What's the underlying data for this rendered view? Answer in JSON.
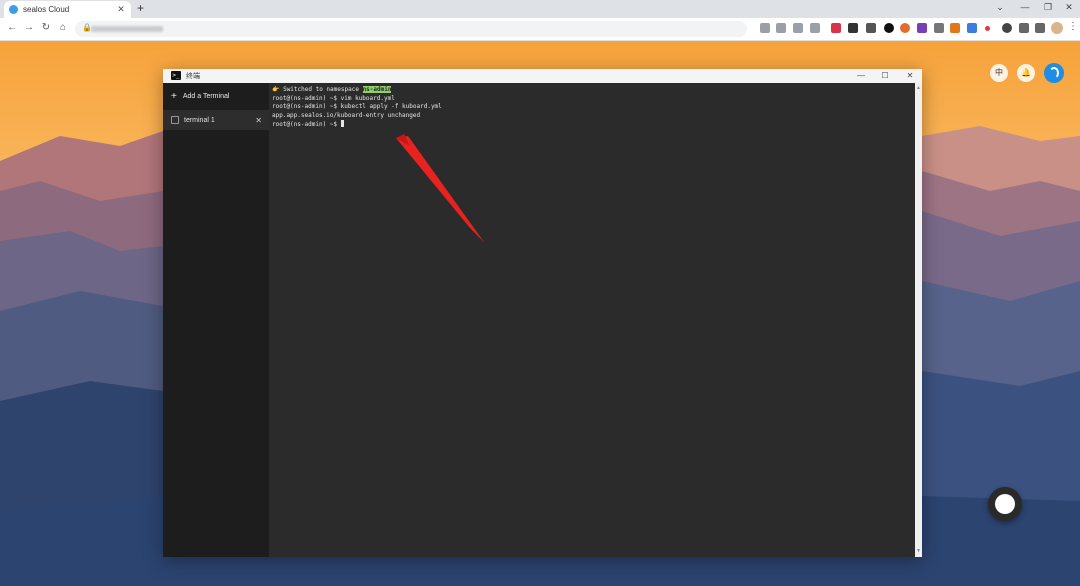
{
  "browser": {
    "tab_title": "sealos Cloud",
    "tab_close": "✕",
    "new_tab": "+",
    "window_controls": {
      "collapse": "⌄",
      "minimize": "—",
      "restore": "❐",
      "close": "✕"
    },
    "nav": {
      "back": "←",
      "forward": "→",
      "reload": "↻",
      "home": "⌂"
    },
    "lock": "🔒",
    "menu": "⋮"
  },
  "desktop": {
    "language_button": "中",
    "bell": "🔔"
  },
  "terminal_window": {
    "title": "终端",
    "icon_glyph": ">_",
    "controls": {
      "minimize": "—",
      "maximize": "☐",
      "close": "✕"
    },
    "sidebar": {
      "add_label": "Add a Terminal",
      "add_plus": "+",
      "items": [
        {
          "label": "terminal 1",
          "close": "✕"
        }
      ]
    },
    "console": {
      "line1_prefix": "👉 Switched to namespace ",
      "line1_ns": "ns-admin",
      "line2": "root@(ns-admin) ~$ vim kuboard.yml",
      "line3": "root@(ns-admin) ~$ kubectl apply -f kuboard.yml",
      "line4": "app.app.sealos.io/kuboard-entry unchanged",
      "line5": "root@(ns-admin) ~$ "
    },
    "scroll_up": "▲",
    "scroll_down": "▼"
  },
  "colors": {
    "annotation_arrow": "#e8221f",
    "namespace_highlight": "#8fd06a",
    "sealos_blue": "#1f8de6"
  }
}
